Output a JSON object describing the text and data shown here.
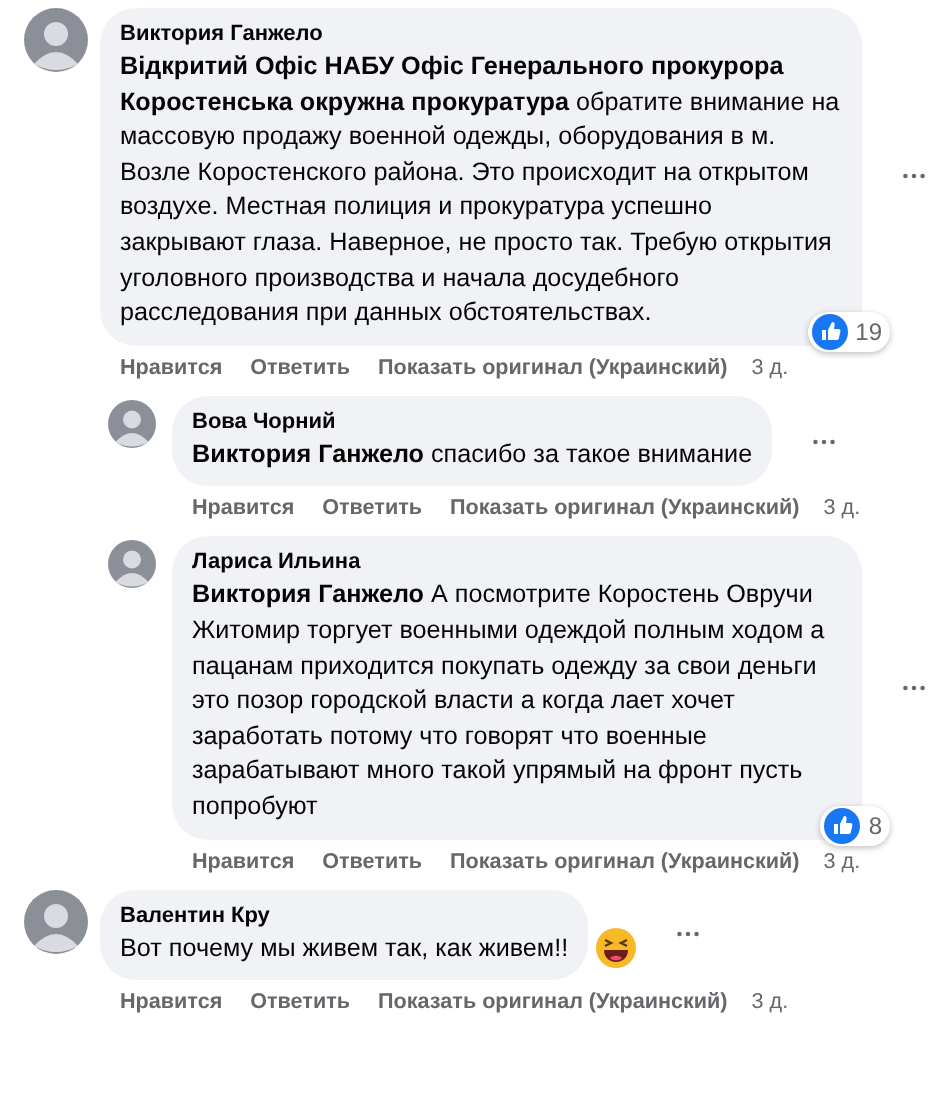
{
  "comments": [
    {
      "author": "Виктория Ганжело",
      "text": "**Відкритий Офіс НАБУ Офіс Генерального прокурора Коростенська окружна прокуратура** обратите внимание на массовую продажу военной одежды, оборудования в м. Возле Коростенского района. Это происходит на открытом воздухе. Местная полиция и прокуратура успешно закрывают глаза. Наверное, не просто так. Требую открытия уголовного производства и начала досудебного расследования при данных обстоятельствах.",
      "reply": false,
      "actions": [
        "Нравится",
        "Ответить",
        "Показать оригинал (Украинский)"
      ],
      "time": "3 д.",
      "reactions": "19"
    },
    {
      "author": "Вова Чорний",
      "text": "**Виктория Ганжело** спасибо за такое внимание",
      "reply": true,
      "actions": [
        "Нравится",
        "Ответить",
        "Показать оригинал (Украинский)"
      ],
      "time": "3 д."
    },
    {
      "author": "Лариса Ильина",
      "text": "**Виктория Ганжело** А посмотрите Коростень Овручи Житомир  торгует военными одеждой полным ходом а пацанам приходится покупать одежду за свои деньги это позор городской власти а когда лает хочет заработать потому что говорят что военные зарабатывают много такой упрямый на фронт пусть попробуют",
      "reply": true,
      "actions": [
        "Нравится",
        "Ответить",
        "Показать оригинал (Украинский)"
      ],
      "time": "3 д.",
      "reactions": "8"
    },
    {
      "author": "Валентин Кру",
      "text": "Вот почему мы живем так, как живем!!",
      "reply": false,
      "actions": [
        "Нравится",
        "Ответить",
        "Показать оригинал (Украинский)"
      ],
      "time": "3 д.",
      "laughing_emoji": true
    }
  ]
}
